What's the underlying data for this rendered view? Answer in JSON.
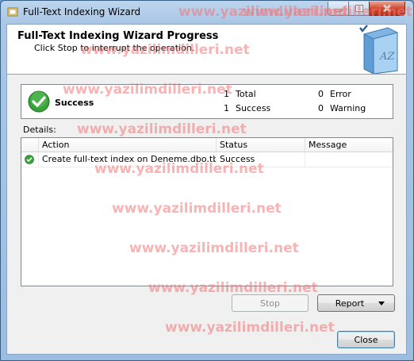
{
  "window": {
    "title": "Full-Text Indexing Wizard"
  },
  "header": {
    "title": "Full-Text Indexing Wizard Progress",
    "subtitle": "Click Stop to interrupt the operation."
  },
  "summary": {
    "status": "Success",
    "total_count": "1",
    "total_label": "Total",
    "success_count": "1",
    "success_label": "Success",
    "error_count": "0",
    "error_label": "Error",
    "warning_count": "0",
    "warning_label": "Warning"
  },
  "details": {
    "label": "Details:",
    "columns": [
      "Action",
      "Status",
      "Message"
    ],
    "rows": [
      {
        "icon": "success-check-icon",
        "action": "Create full-text index on Deneme.dbo.tblP...",
        "status": "Success",
        "message": ""
      }
    ]
  },
  "buttons": {
    "stop": "Stop",
    "report": "Report",
    "close": "Close"
  },
  "watermark": "www.yazilimdilleri.net",
  "colors": {
    "accent": "#3c7fb1",
    "success": "#3aa23a",
    "watermark": "#f27676",
    "titlebar": "#bcd5ee"
  }
}
